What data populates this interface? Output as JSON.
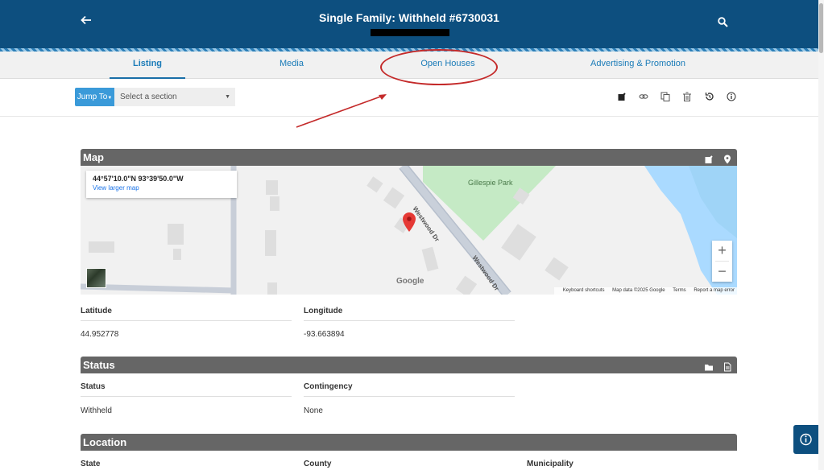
{
  "header": {
    "title": "Single Family: Withheld #6730031",
    "back_icon": "arrow-left-icon",
    "search_icon": "search-icon"
  },
  "tabs": [
    {
      "label": "Listing",
      "active": true
    },
    {
      "label": "Media",
      "active": false
    },
    {
      "label": "Open Houses",
      "active": false
    },
    {
      "label": "Advertising & Promotion",
      "active": false
    }
  ],
  "toolbar": {
    "jump_label": "Jump To",
    "section_select": "Select a section",
    "icons": [
      "edit-icon",
      "link-icon",
      "copy-icon",
      "trash-icon",
      "history-icon",
      "info-icon"
    ]
  },
  "map_section": {
    "title": "Map",
    "coords": "44°57'10.0\"N 93°39'50.0\"W",
    "view_larger": "View larger map",
    "park_label": "Gillespie Park",
    "road_label_1": "Westwood Dr",
    "road_label_2": "Westwood Dr",
    "google_logo": "Google",
    "footer": [
      "Keyboard shortcuts",
      "Map data ©2025 Google",
      "Terms",
      "Report a map error"
    ],
    "zoom_in": "+",
    "zoom_out": "−",
    "latitude_label": "Latitude",
    "latitude_value": "44.952778",
    "longitude_label": "Longitude",
    "longitude_value": "-93.663894"
  },
  "status_section": {
    "title": "Status",
    "status_label": "Status",
    "status_value": "Withheld",
    "contingency_label": "Contingency",
    "contingency_value": "None"
  },
  "location_section": {
    "title": "Location",
    "state_label": "State",
    "county_label": "County",
    "municipality_label": "Municipality"
  },
  "colors": {
    "header_bg": "#0d4f7f",
    "accent": "#3a9ad9",
    "annotation": "#c42a2a",
    "section_bar": "#666666"
  }
}
